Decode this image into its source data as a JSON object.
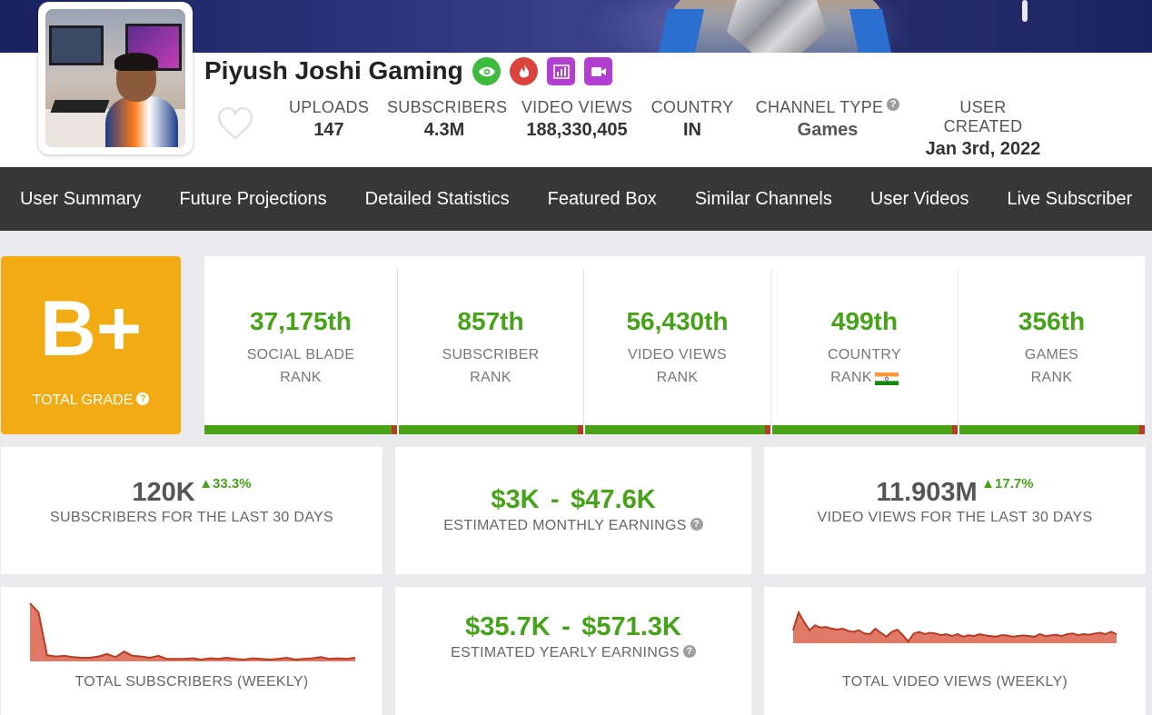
{
  "channel": {
    "name": "Piyush Joshi Gaming",
    "badges": [
      "eye-icon",
      "fire-icon",
      "bar-chart-icon",
      "video-camera-icon"
    ],
    "badge_colors": [
      "#3dbb3d",
      "#d9453d",
      "#b23fd1",
      "#b23fd1"
    ]
  },
  "stats": {
    "uploads": {
      "label": "UPLOADS",
      "value": "147"
    },
    "subscribers": {
      "label": "SUBSCRIBERS",
      "value": "4.3M"
    },
    "video_views": {
      "label": "VIDEO VIEWS",
      "value": "188,330,405"
    },
    "country": {
      "label": "COUNTRY",
      "value": "IN"
    },
    "channel_type": {
      "label": "CHANNEL TYPE",
      "value": "Games",
      "help": "?"
    },
    "user_created": {
      "label": "USER CREATED",
      "value": "Jan 3rd, 2022"
    }
  },
  "nav": {
    "items": [
      "User Summary",
      "Future Projections",
      "Detailed Statistics",
      "Featured Box",
      "Similar Channels",
      "User Videos",
      "Live Subscriber"
    ]
  },
  "grade": {
    "letter": "B+",
    "label": "TOTAL GRADE",
    "help": "?",
    "color": "#f2ab12"
  },
  "ranks": [
    {
      "value": "37,175th",
      "line1": "SOCIAL BLADE",
      "line2": "RANK"
    },
    {
      "value": "857th",
      "line1": "SUBSCRIBER",
      "line2": "RANK"
    },
    {
      "value": "56,430th",
      "line1": "VIDEO VIEWS",
      "line2": "RANK"
    },
    {
      "value": "499th",
      "line1": "COUNTRY",
      "line2": "RANK"
    },
    {
      "value": "356th",
      "line1": "GAMES",
      "line2": "RANK"
    }
  ],
  "cards": {
    "subs30": {
      "value": "120K",
      "delta": "33.3%",
      "caption": "SUBSCRIBERS FOR THE LAST 30 DAYS"
    },
    "monthly": {
      "low": "$3K",
      "sep": "-",
      "high": "$47.6K",
      "caption": "ESTIMATED MONTHLY EARNINGS",
      "help": "?"
    },
    "views30": {
      "value": "11.903M",
      "delta": "17.7%",
      "caption": "VIDEO VIEWS FOR THE LAST 30 DAYS"
    },
    "subs_weekly": {
      "caption": "TOTAL SUBSCRIBERS (WEEKLY)"
    },
    "yearly": {
      "low": "$35.7K",
      "sep": "-",
      "high": "$571.3K",
      "caption": "ESTIMATED YEARLY EARNINGS",
      "help": "?"
    },
    "views_weekly": {
      "caption": "TOTAL VIDEO VIEWS (WEEKLY)"
    }
  },
  "colors": {
    "green": "#45a317",
    "nav_bg": "#373737",
    "spark_fill": "#e07a66",
    "spark_line": "#b63a24"
  },
  "chart_data": [
    {
      "type": "area",
      "values": [
        95,
        80,
        10,
        8,
        9,
        7,
        6,
        6,
        8,
        12,
        7,
        16,
        9,
        8,
        6,
        9,
        4,
        4,
        4,
        5,
        3,
        5,
        4,
        6,
        4,
        3,
        5,
        4,
        3,
        4,
        6,
        3,
        4,
        5,
        7,
        4,
        5,
        4,
        6
      ]
    },
    {
      "type": "area",
      "values": [
        40,
        95,
        65,
        40,
        55,
        48,
        50,
        45,
        42,
        45,
        38,
        35,
        40,
        30,
        28,
        45,
        32,
        20,
        35,
        42,
        25,
        5,
        30,
        35,
        28,
        32,
        30,
        25,
        28,
        22,
        28,
        20,
        25,
        22,
        28,
        24,
        22,
        20,
        25,
        24,
        20,
        22,
        24,
        22,
        20,
        28,
        22,
        24,
        26,
        22,
        28,
        30,
        25,
        28,
        26,
        30,
        32,
        28,
        35,
        28
      ]
    }
  ]
}
